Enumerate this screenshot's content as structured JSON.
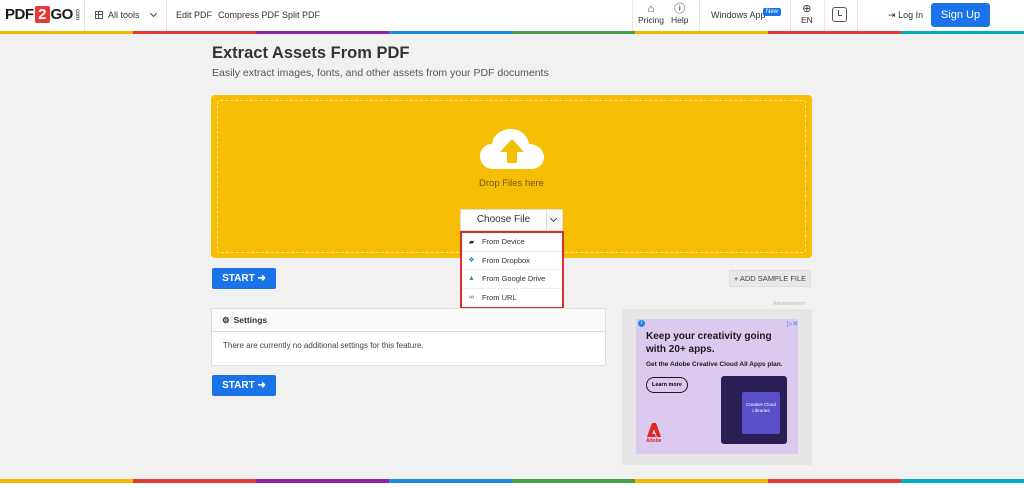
{
  "header": {
    "logo": {
      "part1": "PDF",
      "part2": "2",
      "part3": "GO",
      "suffix": "com"
    },
    "all_tools": "All tools",
    "nav": [
      "Edit PDF",
      "Compress PDF",
      "Split PDF"
    ],
    "pricing": "Pricing",
    "help": "Help",
    "windows_app": "Windows App",
    "new_badge": "New",
    "language": "EN",
    "login": "Log In",
    "signup": "Sign Up"
  },
  "main": {
    "title": "Extract Assets From PDF",
    "subtitle": "Easily extract images, fonts, and other assets from your PDF documents",
    "drop_text": "Drop Files here",
    "choose_file": "Choose File",
    "menu": [
      "From Device",
      "From Dropbox",
      "From Google Drive",
      "From URL"
    ],
    "start": "START",
    "add_sample": "ADD SAMPLE FILE",
    "settings_title": "Settings",
    "settings_body": "There are currently no additional settings for this feature."
  },
  "ad": {
    "label": "Advertisement",
    "headline": "Keep your creativity going with 20+ apps.",
    "sub": "Get the Adobe Creative Cloud All Apps plan.",
    "button": "Learn more",
    "panel_text": "Creative Cloud Libraries",
    "brand": "Adobe"
  },
  "colors": {
    "accent": "#1a73e8",
    "dropzone": "#f5bd04",
    "highlight": "#d32f2f"
  }
}
